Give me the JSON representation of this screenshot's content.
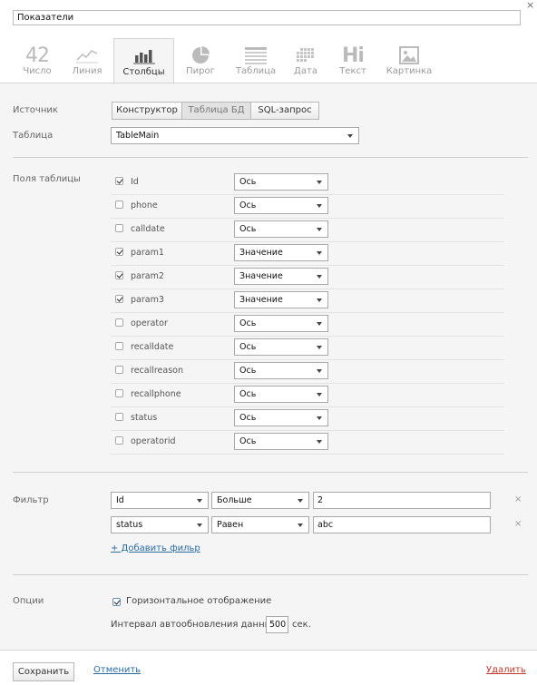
{
  "header": {
    "title_value": "Показатели",
    "close_glyph": "×"
  },
  "tabs": [
    {
      "label": "Число",
      "icon": "number-42-icon",
      "big": "42"
    },
    {
      "label": "Линия",
      "icon": "line-chart-icon"
    },
    {
      "label": "Столбцы",
      "icon": "bar-chart-icon",
      "active": true
    },
    {
      "label": "Пирог",
      "icon": "pie-chart-icon"
    },
    {
      "label": "Таблица",
      "icon": "table-icon"
    },
    {
      "label": "Дата",
      "icon": "calendar-grid-icon"
    },
    {
      "label": "Текст",
      "icon": "text-hi-icon",
      "big": "Hi"
    },
    {
      "label": "Картинка",
      "icon": "picture-icon"
    }
  ],
  "source": {
    "label": "Источник",
    "buttons": [
      "Конструктор",
      "Таблица БД",
      "SQL-запрос"
    ],
    "selected": "Таблица БД"
  },
  "table": {
    "label": "Таблица",
    "value": "TableMain"
  },
  "fields": {
    "label": "Поля таблицы",
    "rows": [
      {
        "name": "Id",
        "checked": true,
        "role": "Ось"
      },
      {
        "name": "phone",
        "checked": false,
        "role": "Ось"
      },
      {
        "name": "calldate",
        "checked": false,
        "role": "Ось"
      },
      {
        "name": "param1",
        "checked": true,
        "role": "Значение"
      },
      {
        "name": "param2",
        "checked": true,
        "role": "Значение"
      },
      {
        "name": "param3",
        "checked": true,
        "role": "Значение"
      },
      {
        "name": "operator",
        "checked": false,
        "role": "Ось"
      },
      {
        "name": "recalldate",
        "checked": false,
        "role": "Ось"
      },
      {
        "name": "recallreason",
        "checked": false,
        "role": "Ось"
      },
      {
        "name": "recallphone",
        "checked": false,
        "role": "Ось"
      },
      {
        "name": "status",
        "checked": false,
        "role": "Ось"
      },
      {
        "name": "operatorid",
        "checked": false,
        "role": "Ось"
      }
    ]
  },
  "filter": {
    "label": "Фильтр",
    "rows": [
      {
        "field": "Id",
        "op": "Больше",
        "value": "2"
      },
      {
        "field": "status",
        "op": "Равен",
        "value": "abc"
      }
    ],
    "remove_glyph": "×",
    "add_link": "+ Добавить фильр"
  },
  "options": {
    "label": "Опции",
    "horizontal_label": "Горизонтальное отображение",
    "horizontal_checked": true,
    "refresh_label": "Интервал автообновления данных",
    "refresh_value": "500",
    "refresh_unit": "сек."
  },
  "footer": {
    "save": "Сохранить",
    "cancel": "Отменить",
    "delete": "Удалить"
  },
  "colors": {
    "link": "#2a6ca3",
    "active_tab_bg": "#f5f5f5",
    "icon_gray": "#bbbbbb"
  }
}
